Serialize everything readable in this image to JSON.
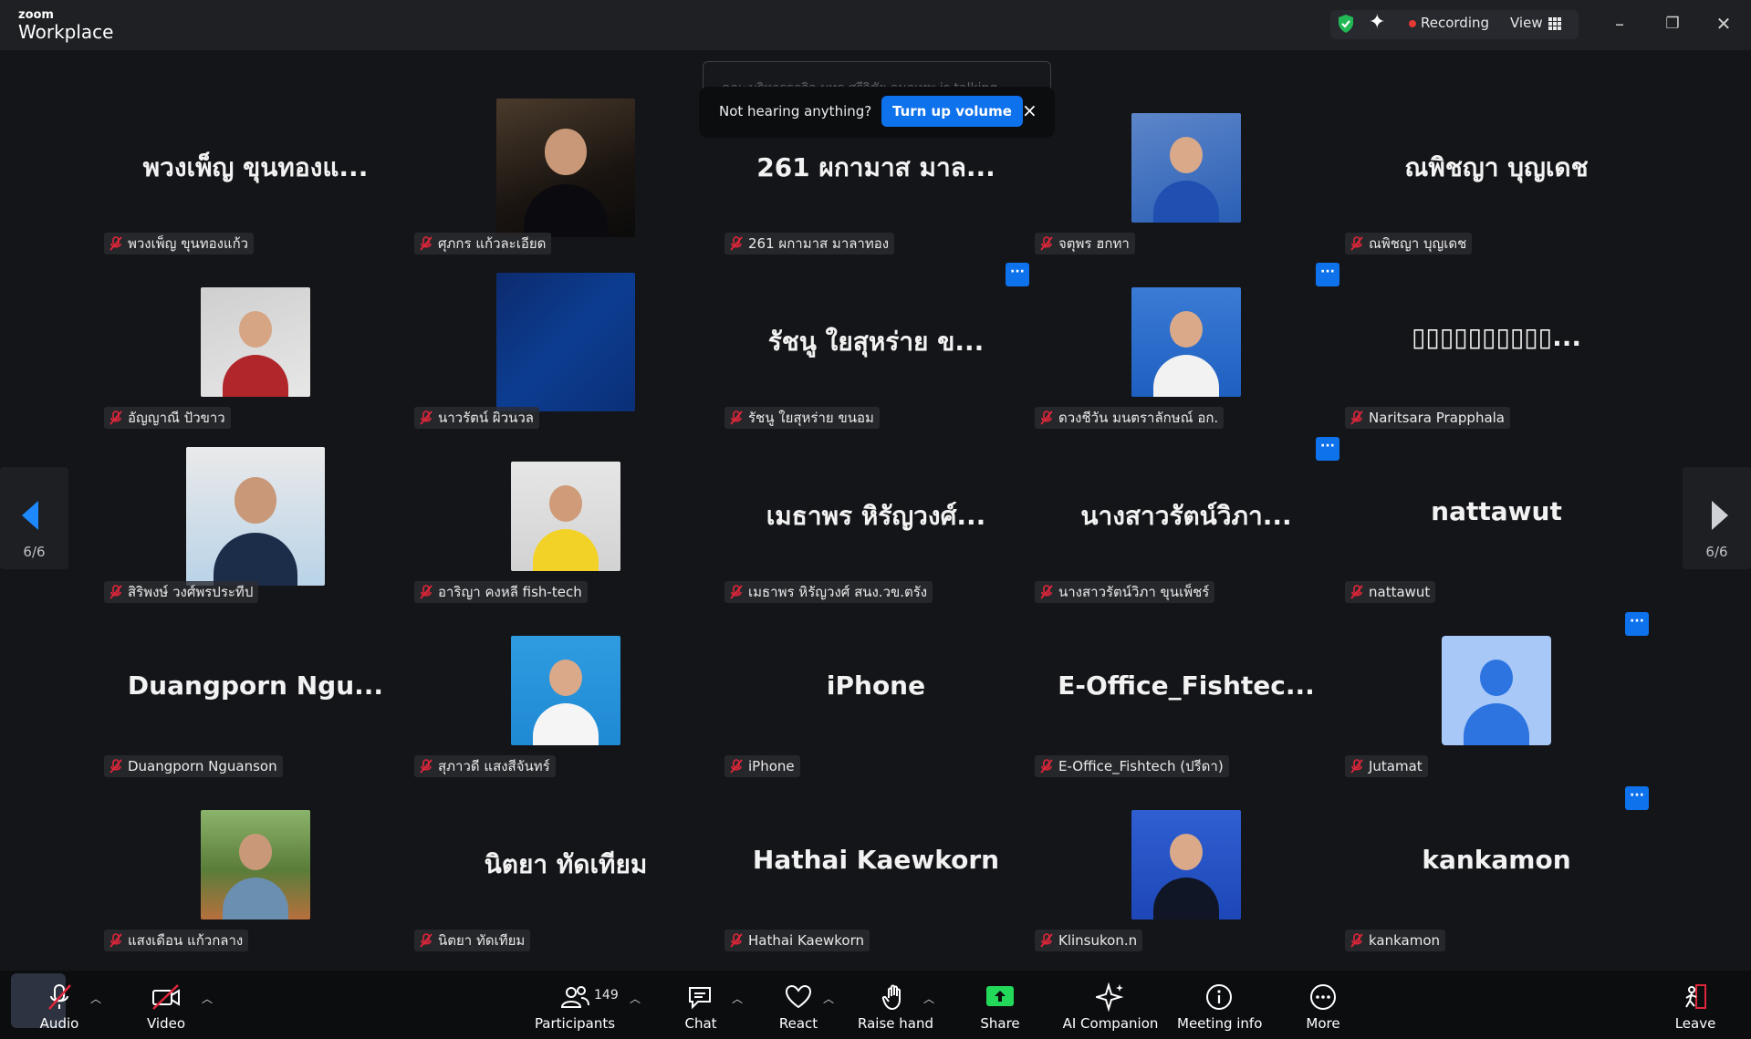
{
  "app": {
    "brand_top": "zoom",
    "brand_bottom": "Workplace"
  },
  "titlebar": {
    "recording": "Recording",
    "view": "View",
    "minimize": "–",
    "restore": "❐",
    "close": "✕"
  },
  "toast": {
    "behind_text": "คณะบริหารธุรกิจ มทร.ศรีวิชัย กมลเทพ is talking...",
    "message": "Not hearing anything?",
    "button": "Turn up volume",
    "close": "×"
  },
  "pagination": {
    "left_page": "6/6",
    "right_page": "6/6"
  },
  "participants": [
    {
      "tile_name": "พวงเพ็ญ ขุนทองแ...",
      "label": "พวงเพ็ญ ขุนทองแก้ว",
      "photo": ""
    },
    {
      "tile_name": "",
      "label": "ศุภกร แก้วละเอียด",
      "photo": "man-in-suit"
    },
    {
      "tile_name": "261 ผกามาส มาล...",
      "label": "261 ผกามาส มาลาทอง",
      "photo": ""
    },
    {
      "tile_name": "",
      "label": "จตุพร ฮกทา",
      "photo": "woman-glasses"
    },
    {
      "tile_name": "ณพิชญา บุญเดช",
      "label": "ณพิชญา บุญเดช",
      "photo": ""
    },
    {
      "tile_name": "",
      "label": "อัญญาณี ปัวขาว",
      "photo": "woman-smiling"
    },
    {
      "tile_name": "",
      "label": "นาวรัตน์ ผิวนวล",
      "photo": "blue-graphic"
    },
    {
      "tile_name": "รัชนู  ใยสุหร่าย ข...",
      "label": "รัชนู  ใยสุหร่าย ขนอม",
      "photo": ""
    },
    {
      "tile_name": "",
      "label": "ดวงชีวัน มนตราลักษณ์ อก.",
      "photo": "woman-uniform"
    },
    {
      "tile_name": "▯▯▯▯▯▯▯▯▯▯...",
      "label": "Naritsara Prapphala",
      "photo": ""
    },
    {
      "tile_name": "",
      "label": "สิริพงษ์ วงศ์พรประทีป",
      "photo": "man-arms-crossed"
    },
    {
      "tile_name": "",
      "label": "อาริญา คงหลี fish-tech",
      "photo": "woman-yellow"
    },
    {
      "tile_name": "เมธาพร หิรัญวงศ์...",
      "label": "เมธาพร หิรัญวงศ์ สนง.วข.ตรัง",
      "photo": ""
    },
    {
      "tile_name": "นางสาวรัตน์วิภา...",
      "label": "นางสาวรัตน์วิภา ขุนเพ็ชร์",
      "photo": ""
    },
    {
      "tile_name": "nattawut",
      "label": "nattawut",
      "photo": ""
    },
    {
      "tile_name": "Duangporn  Ngu...",
      "label": "Duangporn Nguanson",
      "photo": ""
    },
    {
      "tile_name": "",
      "label": "สุภาวดี แสงสีจันทร์",
      "photo": "woman-id"
    },
    {
      "tile_name": "iPhone",
      "label": "iPhone",
      "photo": ""
    },
    {
      "tile_name": "E-Office_Fishtec...",
      "label": "E-Office_Fishtech (ปรีดา)",
      "photo": ""
    },
    {
      "tile_name": "",
      "label": "Jutamat",
      "photo": "default-avatar"
    },
    {
      "tile_name": "",
      "label": "แสงเดือน แก้วกลาง",
      "photo": "person-garden"
    },
    {
      "tile_name": "นิตยา ทัดเทียม",
      "label": "นิตยา ทัดเทียม",
      "photo": ""
    },
    {
      "tile_name": "Hathai Kaewkorn",
      "label": "Hathai Kaewkorn",
      "photo": ""
    },
    {
      "tile_name": "",
      "label": "Klinsukon.n",
      "photo": "woman-blue-bg"
    },
    {
      "tile_name": "kankamon",
      "label": "kankamon",
      "photo": ""
    }
  ],
  "toolbar": {
    "audio": "Audio",
    "video": "Video",
    "participants": "Participants",
    "participants_count": "149",
    "chat": "Chat",
    "react": "React",
    "raise_hand": "Raise hand",
    "share": "Share",
    "ai_companion": "AI Companion",
    "meeting_info": "Meeting info",
    "more": "More",
    "leave": "Leave"
  },
  "colors": {
    "accent": "#0e72ed",
    "share_green": "#23d959",
    "muted_red": "#e0263a",
    "background": "#141518"
  }
}
